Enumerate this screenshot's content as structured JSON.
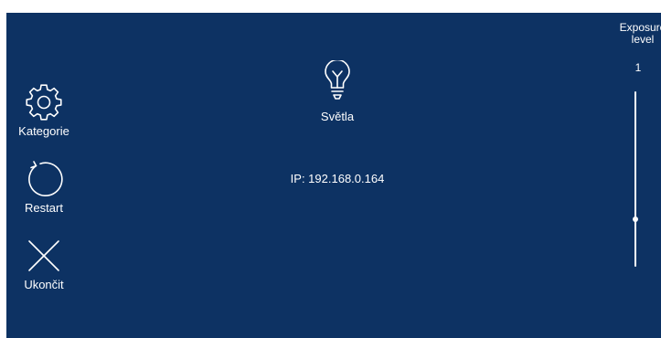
{
  "menu": {
    "kategorie_label": "Kategorie",
    "restart_label": "Restart",
    "ukoncit_label": "Ukončit"
  },
  "main": {
    "lights_label": "Světla",
    "ip_text": "IP: 192.168.0.164"
  },
  "exposure": {
    "title_line1": "Exposure",
    "title_line2": "level",
    "value_label": "1",
    "slider_fraction": 0.27
  },
  "icons": {
    "kategorie": "gear-icon",
    "restart": "refresh-icon",
    "ukoncit": "close-icon",
    "lights": "lightbulb-icon"
  },
  "colors": {
    "background": "#0d3263",
    "foreground": "#ffffff"
  }
}
